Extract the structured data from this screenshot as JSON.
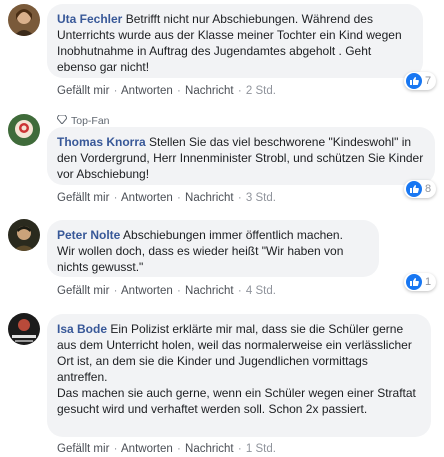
{
  "action_labels": {
    "like": "Gefällt mir",
    "reply": "Antworten",
    "message": "Nachricht"
  },
  "separator": "·",
  "colors": {
    "link": "#385898",
    "bubble": "#f2f3f5",
    "like_blue": "#1877f2",
    "meta": "#90949c"
  },
  "comments": [
    {
      "author": "Uta Fechler",
      "text": "Betrifft nicht nur Abschiebungen. Während des Unterrichts wurde aus der Klasse meiner Tochter ein Kind wegen Inobhutnahme in Auftrag des Jugendamtes abgeholt . Geht ebenso gar nicht!",
      "time": "2 Std.",
      "reactions": "7",
      "avatar_icon": "profile-photo"
    },
    {
      "badge": "Top-Fan",
      "badge_icon": "diamond-icon",
      "author": "Thomas Knorra",
      "text": "Stellen Sie das viel beschworene \"Kindeswohl\" in den Vordergrund, Herr Innenminister Strobl, und schützen Sie Kinder vor Abschiebung!",
      "time": "3 Std.",
      "reactions": "8",
      "avatar_icon": "profile-photo"
    },
    {
      "author": "Peter Nolte",
      "text": "Abschiebungen immer öffentlich machen.",
      "text2": "Wir wollen doch, dass es wieder heißt \"Wir haben von nichts gewusst.\"",
      "time": "4 Std.",
      "reactions": "1",
      "avatar_icon": "profile-photo"
    },
    {
      "author": "Isa Bode",
      "text": "Ein Polizist erklärte mir mal, dass sie die Schüler gerne aus dem Unterricht holen, weil das normalerweise ein verlässlicher Ort ist, an dem sie die Kinder und Jugendlichen vormittags antreffen.",
      "text2": "Das machen sie auch gerne, wenn ein Schüler wegen einer Straftat gesucht wird und verhaftet werden soll. Schon 2x passiert.",
      "time": "1 Std.",
      "avatar_icon": "profile-photo"
    }
  ]
}
